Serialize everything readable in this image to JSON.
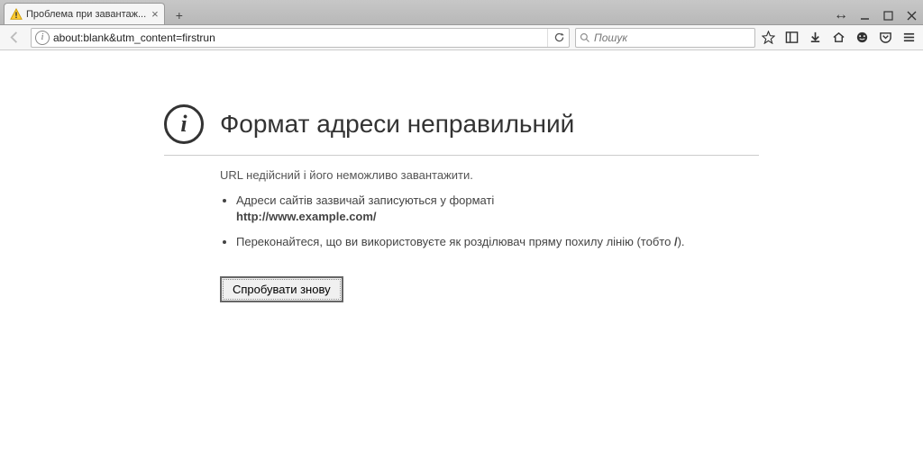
{
  "tab": {
    "title": "Проблема при завантаж..."
  },
  "urlbar": {
    "value": "about:blank&utm_content=firstrun"
  },
  "searchbar": {
    "placeholder": "Пошук"
  },
  "error": {
    "title": "Формат адреси неправильний",
    "desc": "URL недійсний і його неможливо завантажити.",
    "bullet1_a": "Адреси сайтів зазвичай записуються у форматі",
    "bullet1_b": "http://www.example.com/",
    "bullet2_a": "Переконайтеся, що ви використовуєте як розділювач пряму похилу лінію (тобто ",
    "bullet2_b": "/",
    "bullet2_c": ").",
    "retry": "Спробувати знову"
  }
}
